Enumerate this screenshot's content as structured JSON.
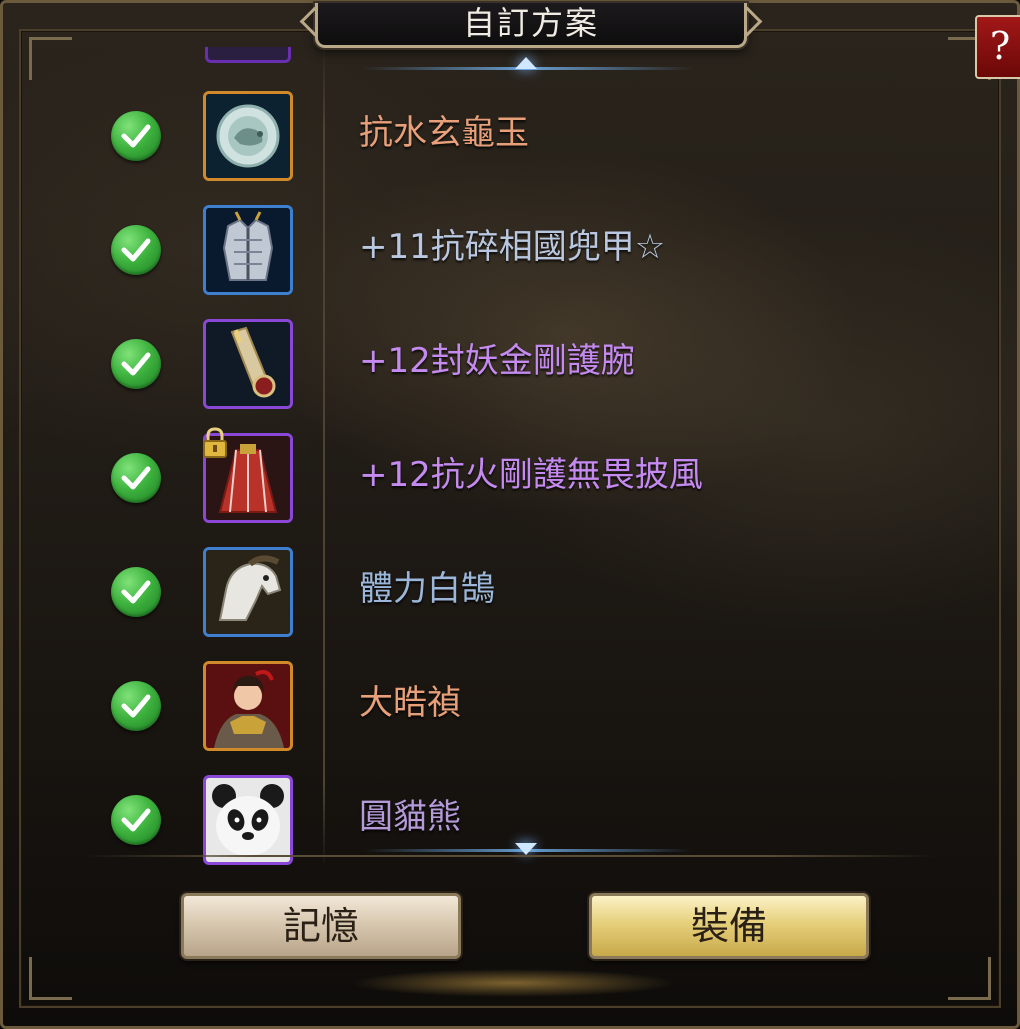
{
  "window": {
    "title": "自訂方案",
    "help_label": "?"
  },
  "items": [
    {
      "checked": true,
      "name": "抗水玄龜玉",
      "name_color": "#e7a07a",
      "icon": "jade-disc-icon",
      "frame_color": "#d08a2a",
      "locked": false
    },
    {
      "checked": true,
      "name": "+11抗碎相國兜甲☆",
      "name_color": "#b9c8e0",
      "icon": "armor-icon",
      "frame_color": "#3f7fd0",
      "locked": false
    },
    {
      "checked": true,
      "name": "+12封妖金剛護腕",
      "name_color": "#c48af0",
      "icon": "bracer-icon",
      "frame_color": "#8b47d8",
      "locked": false
    },
    {
      "checked": true,
      "name": "+12抗火剛護無畏披風",
      "name_color": "#c48af0",
      "icon": "cloak-icon",
      "frame_color": "#8b47d8",
      "locked": true
    },
    {
      "checked": true,
      "name": "體力白鵠",
      "name_color": "#9bb6d8",
      "icon": "horse-icon",
      "frame_color": "#3f7fd0",
      "locked": false
    },
    {
      "checked": true,
      "name": "大晧禎",
      "name_color": "#e7a07a",
      "icon": "heroine-portrait-icon",
      "frame_color": "#d08a2a",
      "locked": false
    },
    {
      "checked": true,
      "name": "圓貓熊",
      "name_color": "#b49ad8",
      "icon": "panda-icon",
      "frame_color": "#8b47d8",
      "locked": false
    }
  ],
  "buttons": {
    "memory_label": "記憶",
    "equip_label": "裝備"
  }
}
